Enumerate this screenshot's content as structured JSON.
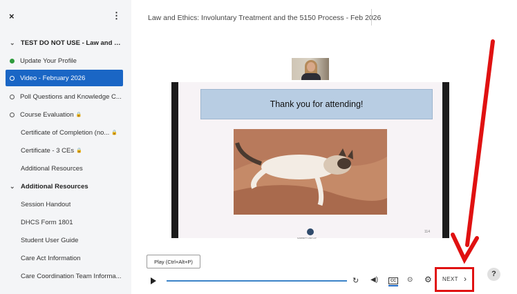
{
  "sidebar": {
    "close_icon": "×",
    "menu_icon": "⋮",
    "items": [
      {
        "label": "TEST DO NOT USE - Law and E...",
        "kind": "section"
      },
      {
        "label": "Update Your Profile",
        "kind": "complete"
      },
      {
        "label": "Video - February 2026",
        "kind": "active"
      },
      {
        "label": "Poll Questions and Knowledge C...",
        "kind": "incomplete"
      },
      {
        "label": "Course Evaluation",
        "kind": "incomplete-locked"
      },
      {
        "label": "Certificate of Completion (no...",
        "kind": "locked"
      },
      {
        "label": "Certificate - 3 CEs",
        "kind": "locked"
      },
      {
        "label": "Additional Resources",
        "kind": "plain"
      },
      {
        "label": "Additional Resources",
        "kind": "section"
      },
      {
        "label": "Session Handout",
        "kind": "plain"
      },
      {
        "label": "DHCS Form 1801",
        "kind": "plain"
      },
      {
        "label": "Student User Guide",
        "kind": "plain"
      },
      {
        "label": "Care Act Information",
        "kind": "plain"
      },
      {
        "label": "Care Coordination Team Informa...",
        "kind": "plain"
      }
    ]
  },
  "header": {
    "title": "Law and Ethics: Involuntary Treatment and the 5150 Process - Feb 2026"
  },
  "video": {
    "slide_title": "Thank you for attending!",
    "slide_logo_text": "GARRETT LAW LLP",
    "slide_number": "114"
  },
  "controls": {
    "tooltip": "Play (Ctrl+Alt+P)",
    "cc_label": "CC",
    "next_label": "NEXT",
    "next_chevron": "›",
    "help_label": "?"
  },
  "icons": {
    "replay": "replay-icon",
    "volume": "volume-icon",
    "speed": "playback-speed-icon",
    "settings": "gear-icon"
  },
  "colors": {
    "active_item": "#1a66c5",
    "complete_dot": "#2e9b3c",
    "annotation": "#e01111",
    "progress": "#3b83c8"
  }
}
